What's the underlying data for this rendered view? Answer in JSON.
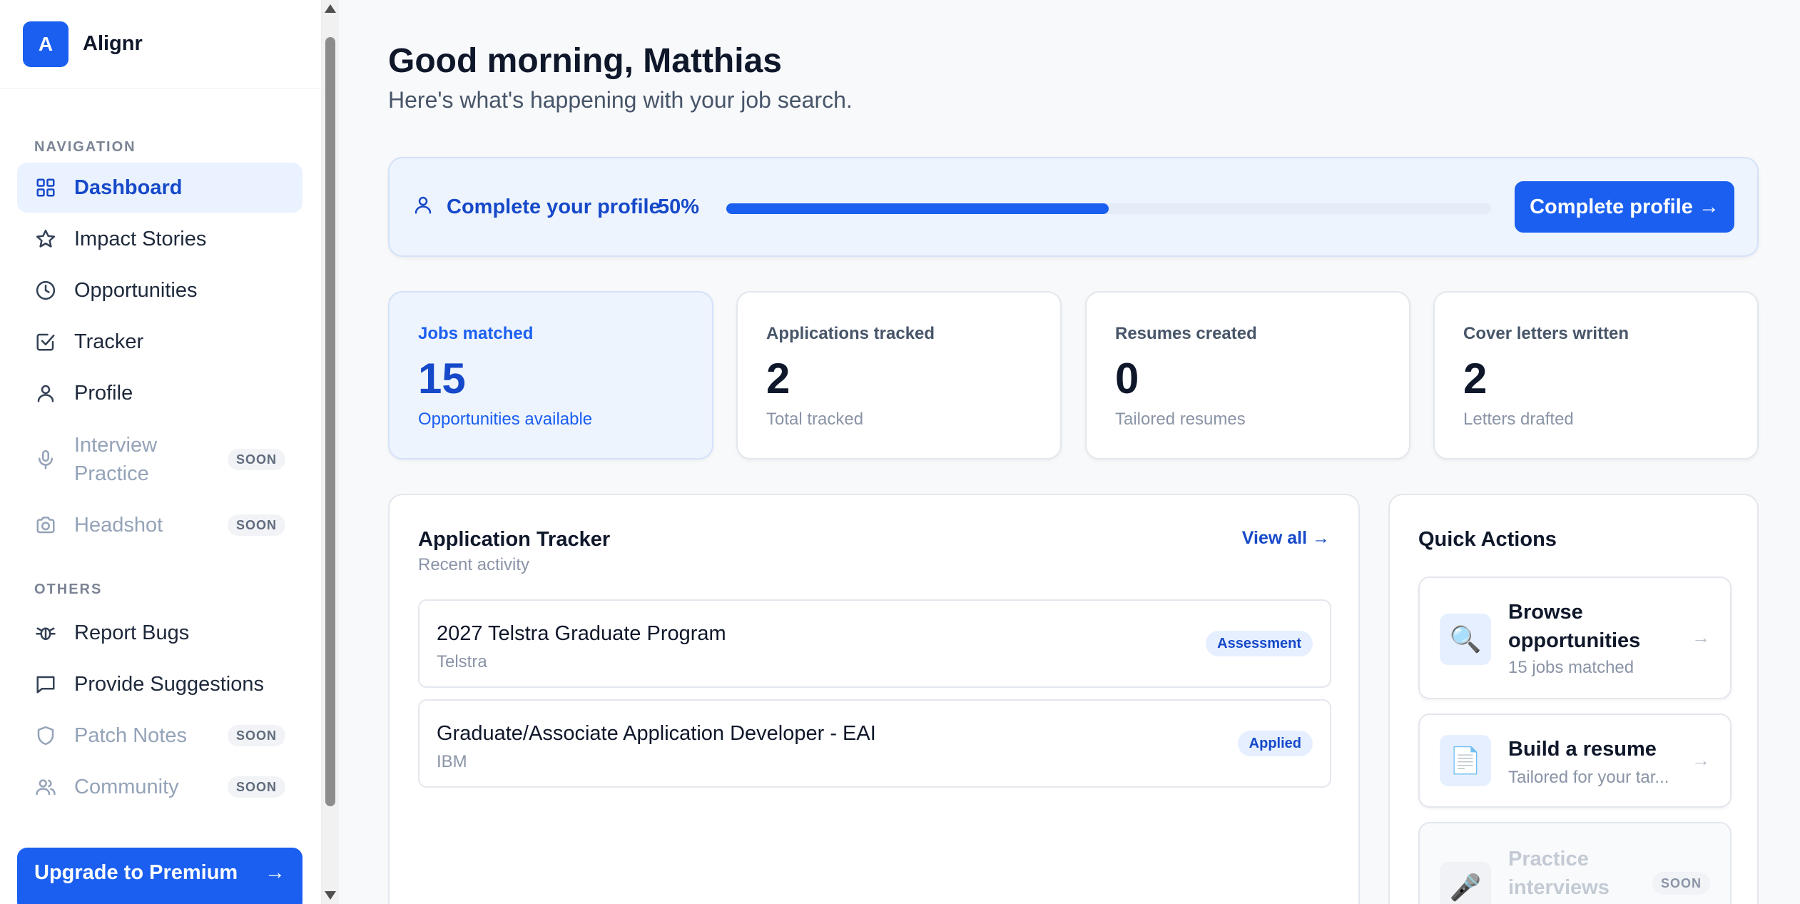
{
  "app": {
    "logo_letter": "A",
    "name": "Alignr"
  },
  "sidebar": {
    "navigation_title": "NAVIGATION",
    "others_title": "OTHERS",
    "nav_items": [
      {
        "label": "Dashboard",
        "icon": "grid-icon",
        "active": true
      },
      {
        "label": "Impact Stories",
        "icon": "star-icon"
      },
      {
        "label": "Opportunities",
        "icon": "clock-icon"
      },
      {
        "label": "Tracker",
        "icon": "checkbox-icon"
      },
      {
        "label": "Profile",
        "icon": "user-icon"
      },
      {
        "label": "Interview Practice",
        "icon": "microphone-icon",
        "badge": "SOON",
        "disabled": true
      },
      {
        "label": "Headshot",
        "icon": "camera-icon",
        "badge": "SOON",
        "disabled": true
      }
    ],
    "other_items": [
      {
        "label": "Report Bugs",
        "icon": "bug-icon"
      },
      {
        "label": "Provide Suggestions",
        "icon": "chat-icon"
      },
      {
        "label": "Patch Notes",
        "icon": "shield-icon",
        "badge": "SOON",
        "disabled": true
      },
      {
        "label": "Community",
        "icon": "users-icon",
        "badge": "SOON",
        "disabled": true
      }
    ],
    "upgrade_label": "Upgrade to Premium",
    "upgrade_arrow": "→"
  },
  "header": {
    "greeting": "Good morning, Matthias",
    "subtitle": "Here's what's happening with your job search."
  },
  "profile_progress": {
    "label": "Complete your profile",
    "percent_text": "50%",
    "percent": 0.5,
    "button_label": "Complete profile →"
  },
  "stats": [
    {
      "label": "Jobs matched",
      "value": "15",
      "sub": "Opportunities available",
      "highlight": true
    },
    {
      "label": "Applications tracked",
      "value": "2",
      "sub": "Total tracked"
    },
    {
      "label": "Resumes created",
      "value": "0",
      "sub": "Tailored resumes"
    },
    {
      "label": "Cover letters written",
      "value": "2",
      "sub": "Letters drafted"
    }
  ],
  "tracker": {
    "title": "Application Tracker",
    "subtitle": "Recent activity",
    "view_all": "View all →",
    "applications": [
      {
        "title": "2027 Telstra Graduate Program",
        "company": "Telstra",
        "status": "Assessment"
      },
      {
        "title": "Graduate/Associate Application Developer - EAI",
        "company": "IBM",
        "status": "Applied"
      }
    ]
  },
  "quick_actions": {
    "title": "Quick Actions",
    "items": [
      {
        "label": "Browse opportunities",
        "sub": "15 jobs matched",
        "icon": "🔍"
      },
      {
        "label": "Build a resume",
        "sub": "Tailored for your tar...",
        "icon": "📄"
      },
      {
        "label": "Practice interviews",
        "icon": "🎤",
        "badge": "SOON",
        "disabled": true
      }
    ],
    "arrow": "→"
  }
}
